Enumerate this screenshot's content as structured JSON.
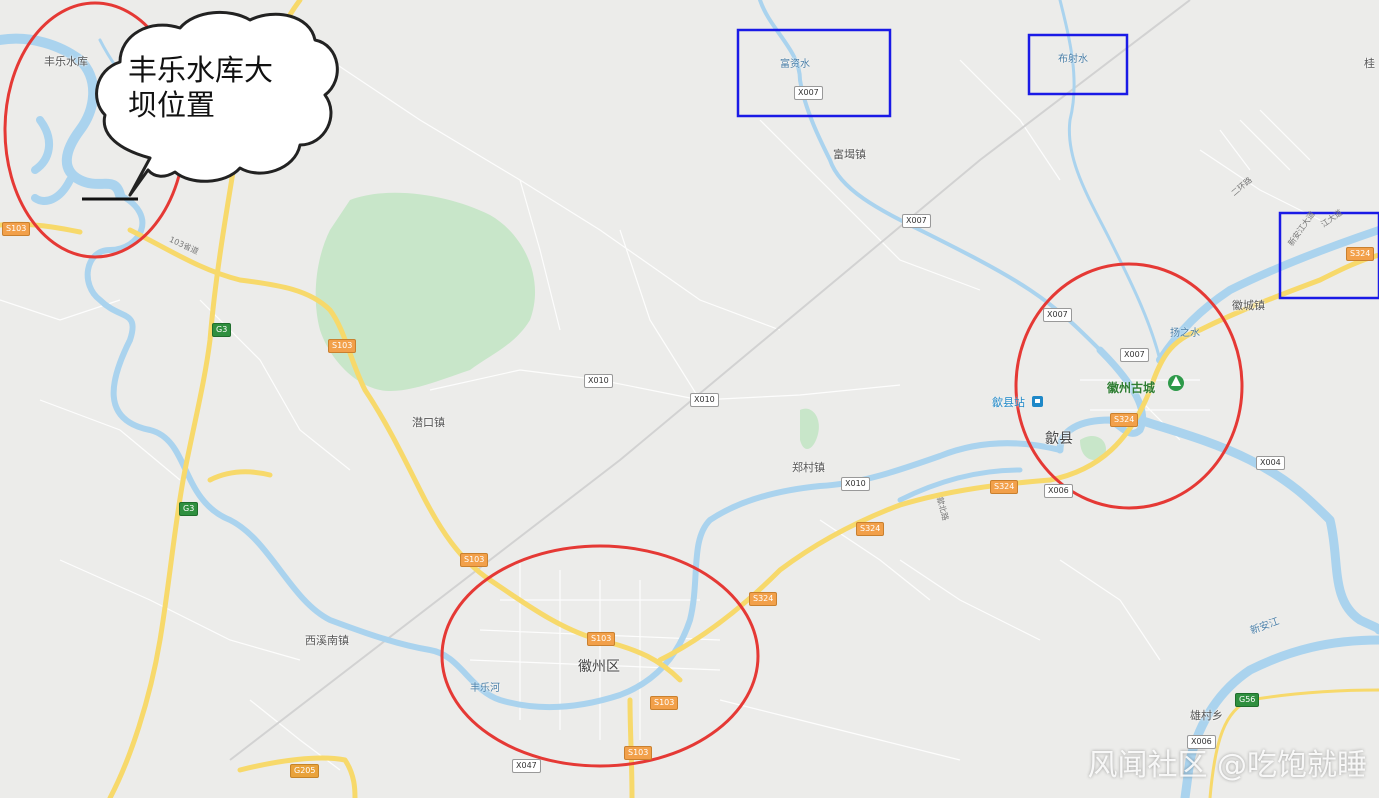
{
  "callout": {
    "line1": "丰乐水库大",
    "line2": "坝位置"
  },
  "labels": {
    "fengle_reservoir": "丰乐水库",
    "fuzi_water": "富资水",
    "bushe_water": "布射水",
    "fu_ti_town": "富堨镇",
    "qiankou_town": "潜口镇",
    "zhengcun_town": "郑村镇",
    "huizhou_district": "徽州区",
    "fengle_river": "丰乐河",
    "xixinan_town": "西溪南镇",
    "shexian": "歙县",
    "huizhou_ancient_city": "徽州古城",
    "shexian_station": "歙县站",
    "yangzhi_water": "扬之水",
    "huicheng_town": "徽城镇",
    "xinan_river": "新安江",
    "xiongcun_town": "雄村乡",
    "gui": "桂",
    "road_103": "103省道",
    "road_ring2": "二环路",
    "road_xinan": "新安江大道",
    "road_xinan2": "江大道",
    "road_shexian_north": "歙北路"
  },
  "shields": {
    "x007_a": "X007",
    "x007_b": "X007",
    "x007_c": "X007",
    "x007_d": "X007",
    "x010_a": "X010",
    "x010_b": "X010",
    "x010_c": "X010",
    "s103_a": "S103",
    "s103_b": "S103",
    "s103_c": "S103",
    "s103_d": "S103",
    "s103_e": "S103",
    "s103_f": "S103",
    "s324_a": "S324",
    "s324_b": "S324",
    "s324_c": "S324",
    "s324_d": "S324",
    "s324_e": "S324",
    "g3_a": "G3",
    "g3_b": "G3",
    "g56": "G56",
    "g205": "G205",
    "x004": "X004",
    "x006": "X006",
    "x006_b": "X006",
    "x047": "X047"
  },
  "watermark": "风闻社区 @吃饱就睡",
  "colors": {
    "background": "#ececea",
    "water": "#aad3ee",
    "park": "#c8e6c9",
    "highway": "#f7d96b",
    "minor_road": "#ffffff",
    "red_annotation": "#e53935",
    "blue_annotation": "#1a1ae6"
  },
  "icons": [
    "tree-icon",
    "train-icon",
    "cloud-callout-icon"
  ]
}
